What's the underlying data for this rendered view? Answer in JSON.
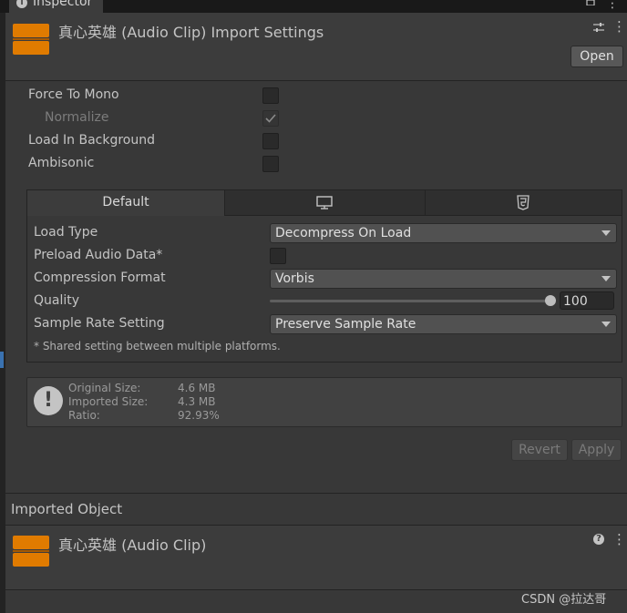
{
  "window": {
    "tab_title": "Inspector"
  },
  "header": {
    "title": "真心英雄 (Audio Clip) Import Settings",
    "open_label": "Open",
    "icon": "audio-clip-icon"
  },
  "options": [
    {
      "label": "Force To Mono",
      "checked": false,
      "disabled": false
    },
    {
      "label": "Normalize",
      "checked": true,
      "disabled": true
    },
    {
      "label": "Load In Background",
      "checked": false,
      "disabled": false
    },
    {
      "label": "Ambisonic",
      "checked": false,
      "disabled": false
    }
  ],
  "platform_tabs": [
    {
      "label": "Default",
      "icon": null,
      "selected": true
    },
    {
      "label": "",
      "icon": "monitor-icon",
      "selected": false
    },
    {
      "label": "",
      "icon": "html5-icon",
      "selected": false
    }
  ],
  "settings": {
    "load_type": {
      "label": "Load Type",
      "value": "Decompress On Load"
    },
    "preload": {
      "label": "Preload Audio Data*",
      "checked": false
    },
    "compression": {
      "label": "Compression Format",
      "value": "Vorbis"
    },
    "quality": {
      "label": "Quality",
      "value": "100",
      "fraction": 1.0
    },
    "sample_rate": {
      "label": "Sample Rate Setting",
      "value": "Preserve Sample Rate"
    },
    "footnote": "* Shared setting between multiple platforms."
  },
  "info": {
    "original_label": "Original Size:",
    "original_value": "4.6 MB",
    "imported_label": "Imported Size:",
    "imported_value": "4.3 MB",
    "ratio_label": "Ratio:",
    "ratio_value": "92.93%"
  },
  "buttons": {
    "revert": "Revert",
    "apply": "Apply"
  },
  "imported_object": {
    "section_title": "Imported Object",
    "name": "真心英雄 (Audio Clip)"
  },
  "watermark": "CSDN @拉达哥",
  "colors": {
    "audio_icon": "#e07b00",
    "accent": "#3a72b0",
    "background": "#383838"
  }
}
